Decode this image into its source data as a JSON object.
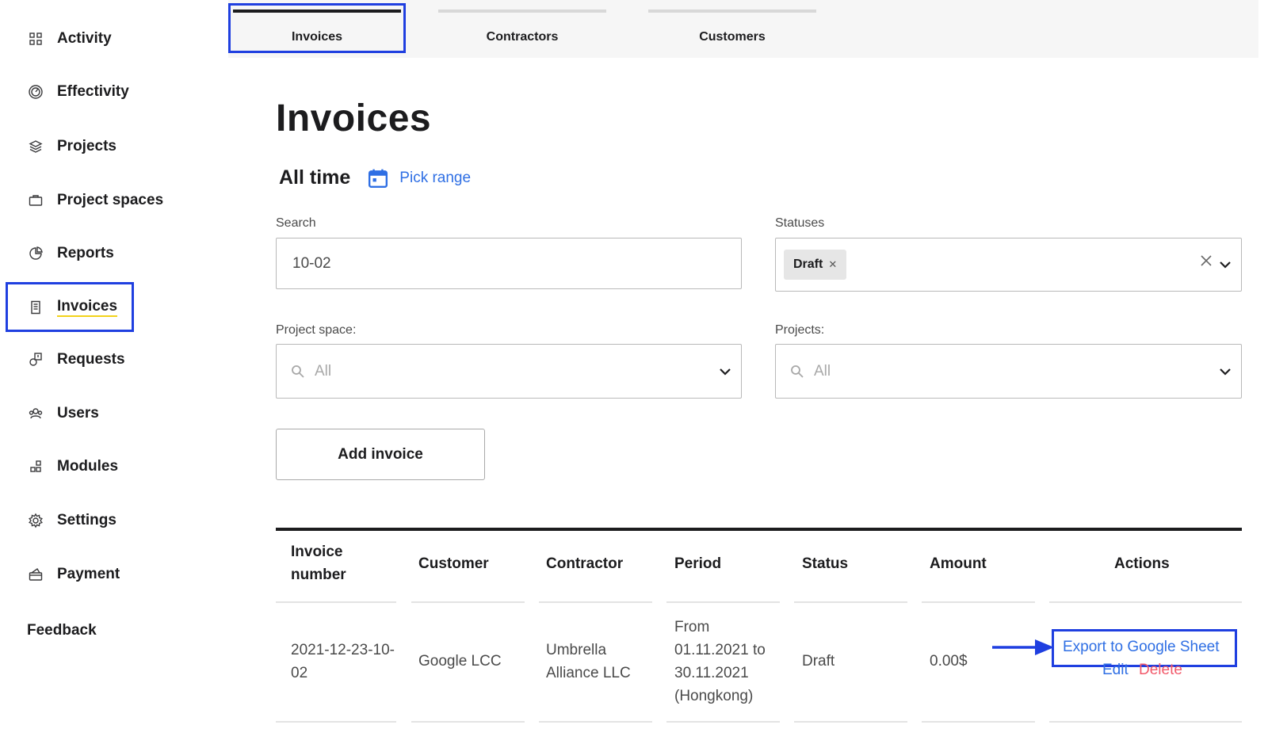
{
  "sidebar": {
    "items": [
      {
        "label": "Activity",
        "icon": "grid-icon"
      },
      {
        "label": "Effectivity",
        "icon": "gauge-icon"
      },
      {
        "label": "Projects",
        "icon": "layers-icon"
      },
      {
        "label": "Project spaces",
        "icon": "briefcase-icon"
      },
      {
        "label": "Reports",
        "icon": "pie-chart-icon"
      },
      {
        "label": "Invoices",
        "icon": "receipt-icon",
        "active": true
      },
      {
        "label": "Requests",
        "icon": "request-icon"
      },
      {
        "label": "Users",
        "icon": "users-icon"
      },
      {
        "label": "Modules",
        "icon": "modules-icon"
      },
      {
        "label": "Settings",
        "icon": "gear-icon"
      },
      {
        "label": "Payment",
        "icon": "payment-icon"
      }
    ],
    "feedback": "Feedback"
  },
  "tabs": [
    {
      "label": "Invoices",
      "active": true
    },
    {
      "label": "Contractors",
      "active": false
    },
    {
      "label": "Customers",
      "active": false
    }
  ],
  "page": {
    "title": "Invoices",
    "range_label": "All time",
    "pick_range": "Pick range"
  },
  "filters": {
    "search_label": "Search",
    "search_value": "10-02",
    "statuses_label": "Statuses",
    "status_chip": "Draft",
    "project_space_label": "Project space:",
    "project_space_placeholder": "All",
    "projects_label": "Projects:",
    "projects_placeholder": "All"
  },
  "add_invoice_label": "Add invoice",
  "table": {
    "headers": {
      "invoice_number_line1": "Invoice",
      "invoice_number_line2": "number",
      "customer": "Customer",
      "contractor": "Contractor",
      "period": "Period",
      "status": "Status",
      "amount": "Amount",
      "actions": "Actions"
    },
    "rows": [
      {
        "invoice_number_line1": "2021-12-23-10-",
        "invoice_number_line2": "02",
        "customer": "Google LCC",
        "contractor_line1": "Umbrella",
        "contractor_line2": "Alliance LLC",
        "period_line1": "From",
        "period_line2": "01.11.2021 to",
        "period_line3": "30.11.2021",
        "period_line4": "(Hongkong)",
        "status": "Draft",
        "amount": "0.00$",
        "export": "Export to Google Sheet",
        "edit": "Edit",
        "delete": "Delete"
      }
    ]
  },
  "colors": {
    "accent_blue": "#2f6fe4",
    "highlight": "#1f3fe0",
    "delete_red": "#f25a6b",
    "active_underline": "#f2d21b"
  }
}
